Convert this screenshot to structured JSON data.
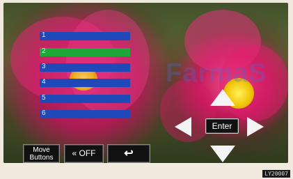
{
  "watermark": "FarmaS",
  "presets": [
    {
      "num": "1",
      "selected": false
    },
    {
      "num": "2",
      "selected": true
    },
    {
      "num": "3",
      "selected": false
    },
    {
      "num": "4",
      "selected": false
    },
    {
      "num": "5",
      "selected": false
    },
    {
      "num": "6",
      "selected": false
    }
  ],
  "buttons": {
    "move_line1": "Move",
    "move_line2": "Buttons",
    "off": "« OFF",
    "back": "↩",
    "enter": "Enter"
  },
  "corner_code": "LY20007"
}
